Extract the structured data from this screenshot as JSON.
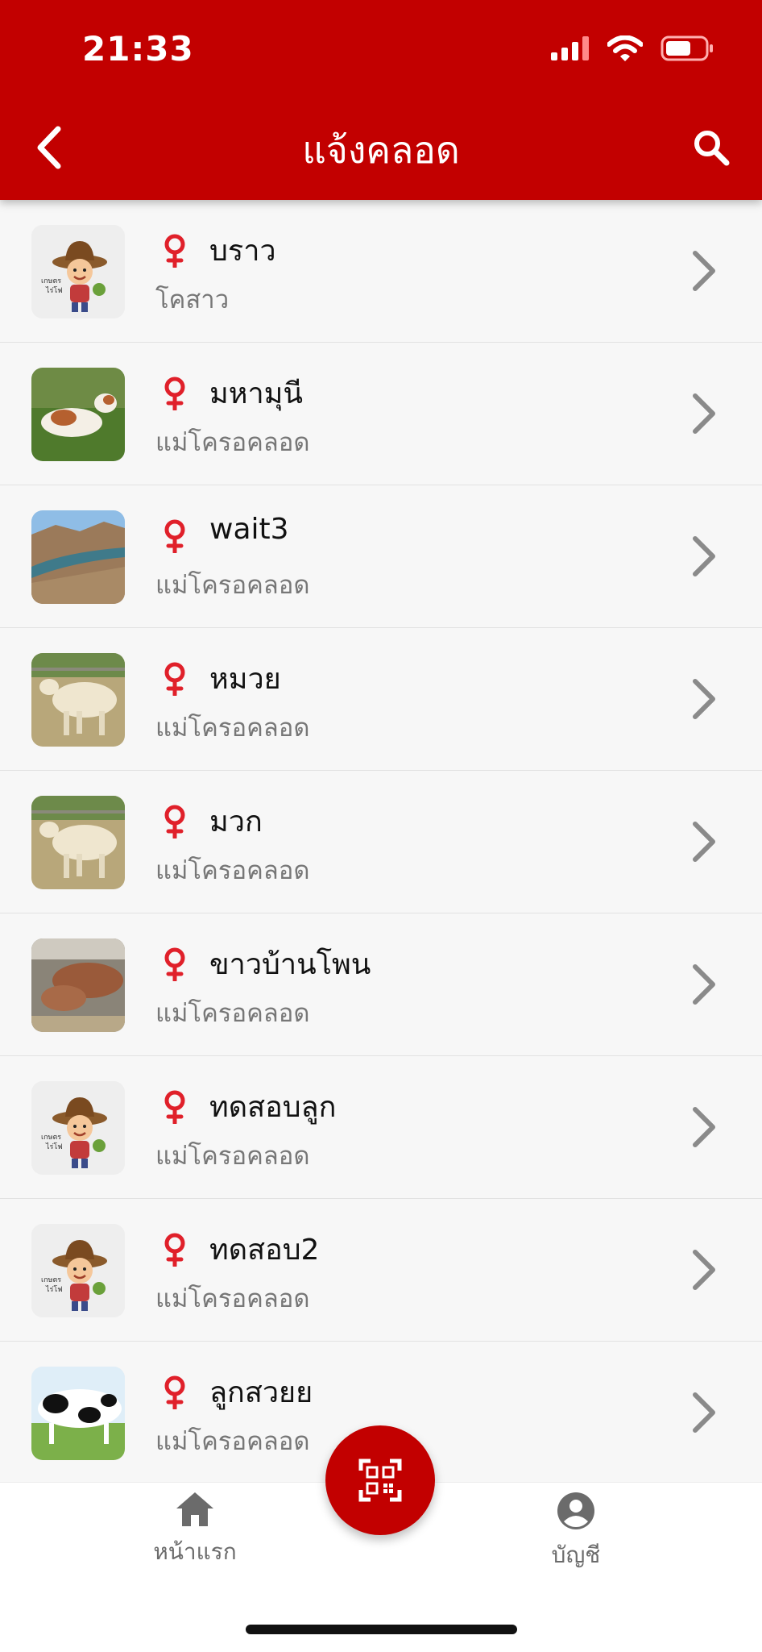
{
  "status_bar": {
    "time": "21:33"
  },
  "header": {
    "title": "แจ้งคลอด"
  },
  "animals": [
    {
      "name": "บราว",
      "status": "โคสาว",
      "photo": "farmer-cartoon"
    },
    {
      "name": "มหามุนี",
      "status": "แม่โครอคลอด",
      "photo": "cow-lying-on-grass"
    },
    {
      "name": "wait3",
      "status": "แม่โครอคลอด",
      "photo": "river-landscape"
    },
    {
      "name": "หมวย",
      "status": "แม่โครอคลอด",
      "photo": "white-cow"
    },
    {
      "name": "มวก",
      "status": "แม่โครอคลอด",
      "photo": "white-cow"
    },
    {
      "name": "ขาวบ้านโพน",
      "status": "แม่โครอคลอด",
      "photo": "brown-cows-in-pen"
    },
    {
      "name": "ทดสอบลูก",
      "status": "แม่โครอคลอด",
      "photo": "farmer-cartoon"
    },
    {
      "name": "ทดสอบ2",
      "status": "แม่โครอคลอด",
      "photo": "farmer-cartoon"
    },
    {
      "name": "ลูกสวยย",
      "status": "แม่โครอคลอด",
      "photo": "holstein-cow"
    }
  ],
  "tabbar": {
    "home_label": "หน้าแรก",
    "account_label": "บัญชี"
  },
  "colors": {
    "brand": "#c20000",
    "female_icon": "#e0202a"
  }
}
